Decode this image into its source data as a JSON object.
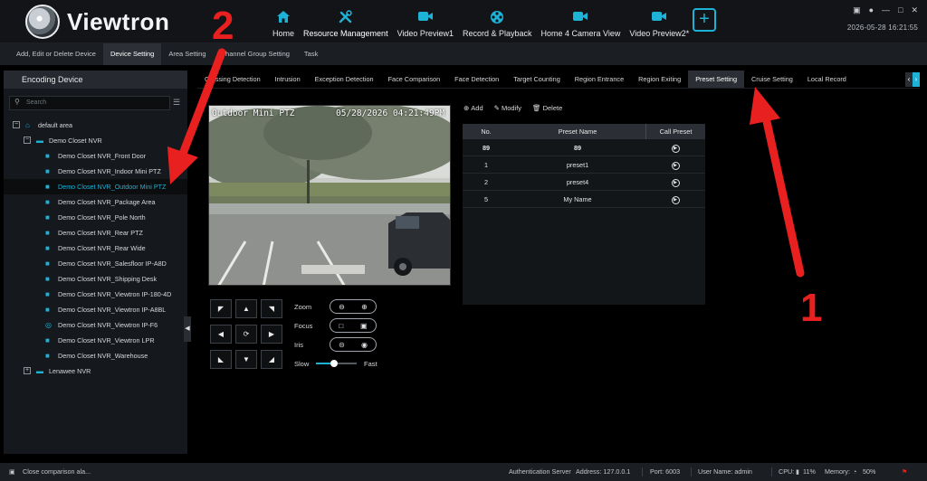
{
  "brand": {
    "name": "Viewtron"
  },
  "nav": {
    "items": [
      {
        "label": "Home",
        "icon": "home-icon"
      },
      {
        "label": "Resource Management",
        "icon": "tools-icon",
        "active": true
      },
      {
        "label": "Video Preview1",
        "icon": "video-camera-icon"
      },
      {
        "label": "Record & Playback",
        "icon": "film-reel-icon"
      },
      {
        "label": "Home 4 Camera View",
        "icon": "video-camera-icon"
      },
      {
        "label": "Video Preview2*",
        "icon": "video-camera-icon"
      }
    ],
    "add_label": "+"
  },
  "top_right": {
    "datetime": "2026-05-28 16:21:55"
  },
  "subtabs": [
    {
      "label": "Add, Edit or Delete Device"
    },
    {
      "label": "Device Setting",
      "active": true
    },
    {
      "label": "Area Setting"
    },
    {
      "label": "Channel Group Setting"
    },
    {
      "label": "Task"
    }
  ],
  "sidebar": {
    "title": "Encoding Device",
    "search_placeholder": "Search",
    "tree": [
      {
        "label": "default area",
        "level": 0,
        "toggle": "−",
        "icon": "home-icon"
      },
      {
        "label": "Demo Closet NVR",
        "level": 1,
        "toggle": "−",
        "icon": "nvr-icon"
      },
      {
        "label": "Demo Closet NVR_Front Door",
        "level": 2,
        "icon": "bullet-camera-icon"
      },
      {
        "label": "Demo Closet NVR_Indoor Mini PTZ",
        "level": 2,
        "icon": "ptz-camera-icon"
      },
      {
        "label": "Demo Closet NVR_Outdoor Mini PTZ",
        "level": 2,
        "icon": "ptz-camera-icon",
        "selected": true
      },
      {
        "label": "Demo Closet NVR_Package Area",
        "level": 2,
        "icon": "bullet-camera-icon"
      },
      {
        "label": "Demo Closet NVR_Pole North",
        "level": 2,
        "icon": "bullet-camera-icon"
      },
      {
        "label": "Demo Closet NVR_Rear PTZ",
        "level": 2,
        "icon": "ptz-camera-icon"
      },
      {
        "label": "Demo Closet NVR_Rear Wide",
        "level": 2,
        "icon": "bullet-camera-icon"
      },
      {
        "label": "Demo Closet NVR_Salesfloor IP-A8D",
        "level": 2,
        "icon": "bullet-camera-icon"
      },
      {
        "label": "Demo Closet NVR_Shipping Desk",
        "level": 2,
        "icon": "bullet-camera-icon"
      },
      {
        "label": "Demo Closet NVR_Viewtron IP-180-4D",
        "level": 2,
        "icon": "bullet-camera-icon"
      },
      {
        "label": "Demo Closet NVR_Viewtron IP-A8BL",
        "level": 2,
        "icon": "bullet-camera-icon"
      },
      {
        "label": "Demo Closet NVR_Viewtron IP-F6",
        "level": 2,
        "icon": "fisheye-camera-icon"
      },
      {
        "label": "Demo Closet NVR_Viewtron LPR",
        "level": 2,
        "icon": "bullet-camera-icon"
      },
      {
        "label": "Demo Closet NVR_Warehouse",
        "level": 2,
        "icon": "bullet-camera-icon"
      },
      {
        "label": "Lenawee NVR",
        "level": 1,
        "toggle": "+",
        "icon": "nvr-icon"
      }
    ]
  },
  "function_tabs": [
    {
      "label": "Crossing Detection"
    },
    {
      "label": "Intrusion"
    },
    {
      "label": "Exception Detection"
    },
    {
      "label": "Face Comparison"
    },
    {
      "label": "Face Detection"
    },
    {
      "label": "Target Counting"
    },
    {
      "label": "Region Entrance"
    },
    {
      "label": "Region Exiting"
    },
    {
      "label": "Preset Setting",
      "active": true
    },
    {
      "label": "Cruise Setting"
    },
    {
      "label": "Local Record"
    }
  ],
  "video": {
    "camera_name": "Outdoor Mini PTZ",
    "timestamp": "05/28/2026 04:21:49PM"
  },
  "ptz": {
    "zoom_label": "Zoom",
    "focus_label": "Focus",
    "iris_label": "Iris",
    "speed_slow": "Slow",
    "speed_fast": "Fast",
    "speed_fraction": 0.45
  },
  "preset": {
    "add_label": "Add",
    "modify_label": "Modify",
    "delete_label": "Delete",
    "columns": {
      "no": "No.",
      "name": "Preset Name",
      "call": "Call Preset"
    },
    "rows": [
      {
        "no": "89",
        "name": "89"
      },
      {
        "no": "1",
        "name": "preset1"
      },
      {
        "no": "2",
        "name": "preset4"
      },
      {
        "no": "5",
        "name": "My Name"
      }
    ]
  },
  "statusbar": {
    "notice": "Close comparison ala...",
    "auth_server": "Authentication Server",
    "address": "Address: 127.0.0.1",
    "port": "Port: 6003",
    "user": "User Name: admin",
    "cpu_label": "CPU:",
    "cpu_value": "11%",
    "memory_label": "Memory:",
    "memory_value": "50%"
  },
  "annotations": {
    "arrow1_label": "1",
    "arrow2_label": "2",
    "color": "#e8201f"
  }
}
